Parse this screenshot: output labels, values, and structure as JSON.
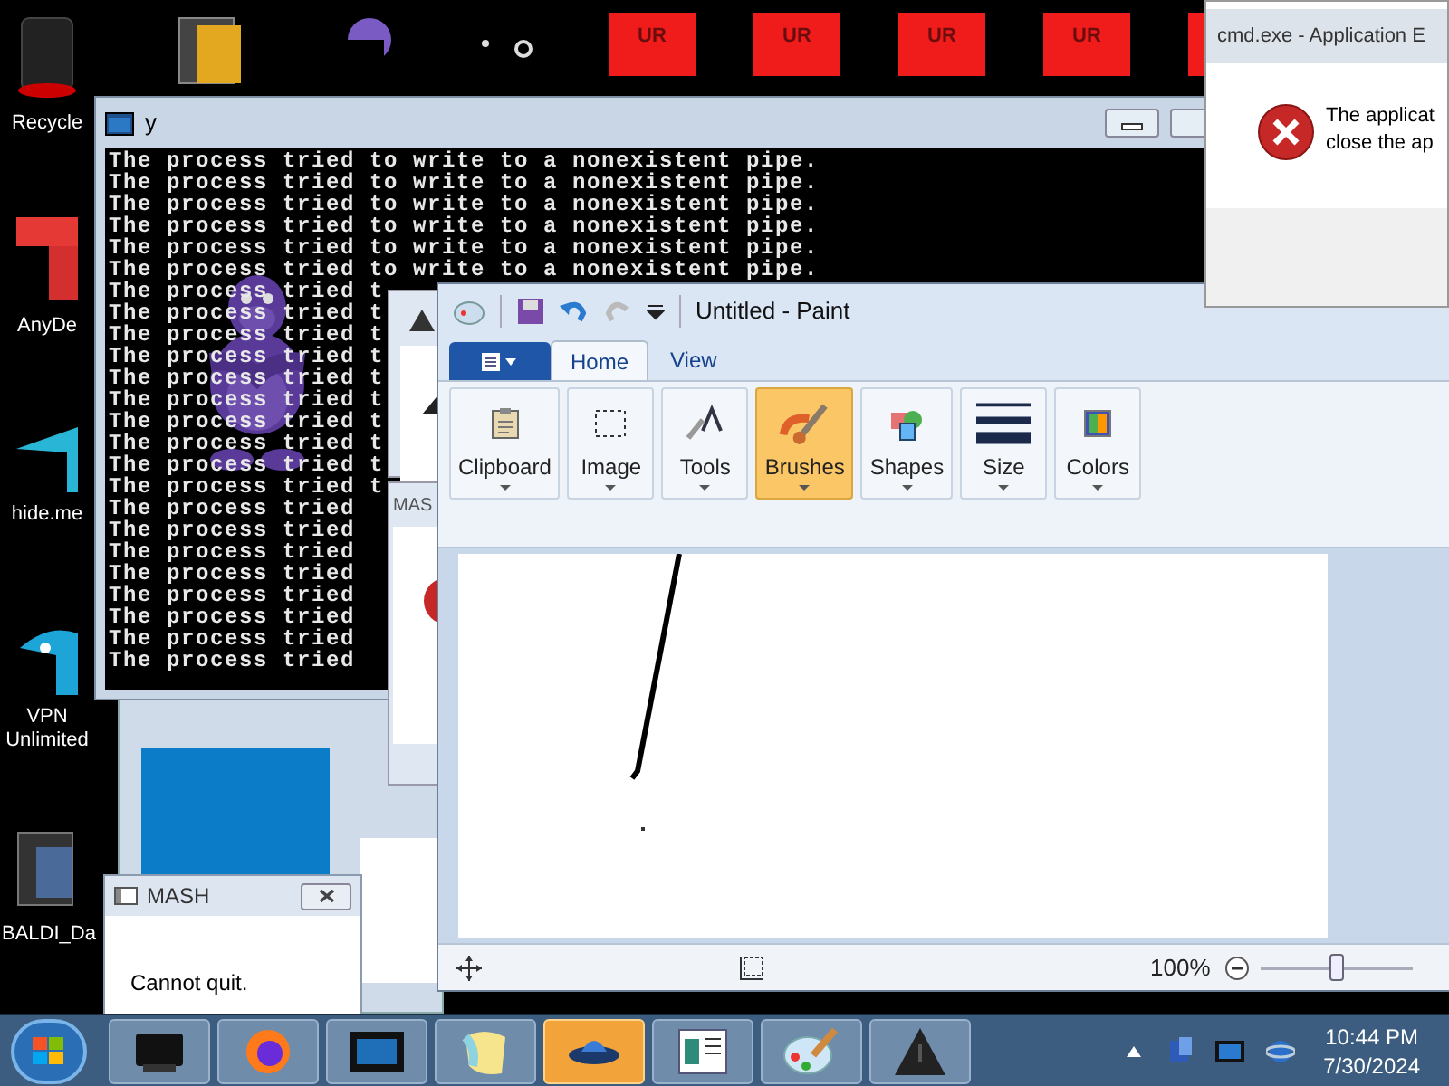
{
  "desktop_icons": [
    {
      "kind": "recycle",
      "label": "Recycle"
    },
    {
      "kind": "anydesk",
      "label": "AnyDe"
    },
    {
      "kind": "hideme",
      "label": "hide.me"
    },
    {
      "kind": "vpn",
      "label": "VPN Unlimited"
    },
    {
      "kind": "baldi",
      "label": "BALDI_Da"
    }
  ],
  "shortcut_tiles": [
    {
      "label": "UR"
    },
    {
      "label": "UR"
    },
    {
      "label": "UR"
    },
    {
      "label": "UR"
    }
  ],
  "console": {
    "title": "y",
    "lines": [
      "The process tried to write to a nonexistent pipe.",
      "The process tried to write to a nonexistent pipe.",
      "The process tried to write to a nonexistent pipe.",
      "The process tried to write to a nonexistent pipe.",
      "The process tried to write to a nonexistent pipe.",
      "The process tried to write to a nonexistent pipe.",
      "The process tried t",
      "The process tried t",
      "The process tried t",
      "The process tried t",
      "The process tried t",
      "The process tried t",
      "The process tried t",
      "The process tried t",
      "The process tried t",
      "The process tried t",
      "The process tried",
      "The process tried",
      "The process tried",
      "The process tried",
      "The process tried",
      "The process tried",
      "The process tried",
      "The process tried"
    ]
  },
  "background_window": {
    "title": "MAS"
  },
  "error_dialog": {
    "title": "cmd.exe - Application E",
    "message": [
      "The applicat",
      "close the ap"
    ]
  },
  "paint": {
    "title": "Untitled - Paint",
    "tabs": [
      {
        "label": "Home",
        "selected": true
      },
      {
        "label": "View",
        "selected": false
      }
    ],
    "groups": [
      {
        "kind": "clipboard",
        "label": "Clipboard",
        "selected": false
      },
      {
        "kind": "image",
        "label": "Image",
        "selected": false
      },
      {
        "kind": "tools",
        "label": "Tools",
        "selected": false
      },
      {
        "kind": "brushes",
        "label": "Brushes",
        "selected": true
      },
      {
        "kind": "shapes",
        "label": "Shapes",
        "selected": false
      },
      {
        "kind": "size",
        "label": "Size",
        "selected": false
      },
      {
        "kind": "colors",
        "label": "Colors",
        "selected": false
      }
    ],
    "zoom": "100%",
    "zoom_slider": {
      "level": 0.5
    }
  },
  "mash_dialog": {
    "title": "MASH",
    "message": "Cannot quit."
  },
  "taskbar": {
    "buttons": [
      {
        "kind": "monitor",
        "selected": false
      },
      {
        "kind": "firefox",
        "selected": false
      },
      {
        "kind": "window",
        "selected": false
      },
      {
        "kind": "paint-blob",
        "selected": false
      },
      {
        "kind": "ufo",
        "selected": true
      },
      {
        "kind": "document",
        "selected": false
      },
      {
        "kind": "palette",
        "selected": false
      },
      {
        "kind": "warning",
        "selected": false
      }
    ],
    "time": "10:44 PM",
    "date": "7/30/2024"
  }
}
